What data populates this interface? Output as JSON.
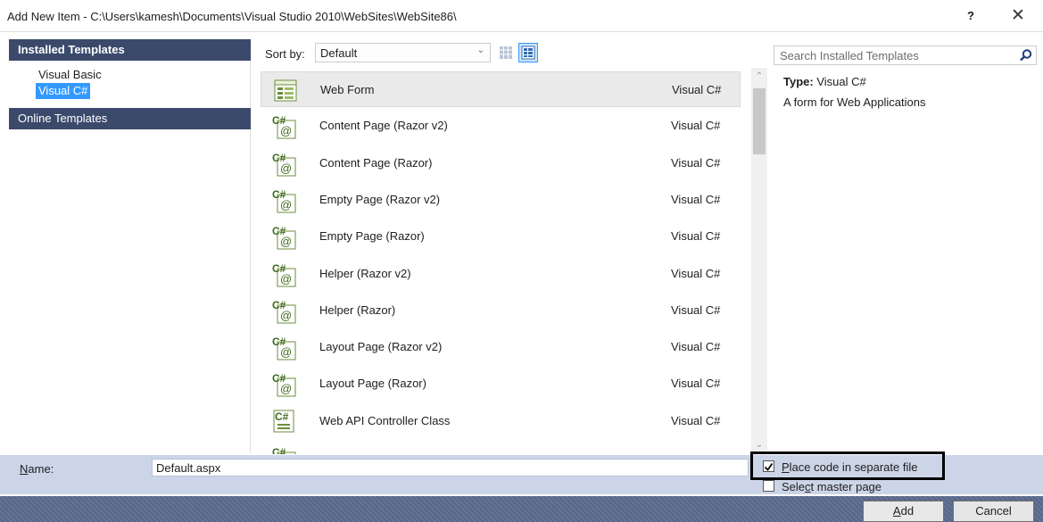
{
  "window": {
    "title": "Add New Item - C:\\Users\\kamesh\\Documents\\Visual Studio 2010\\WebSites\\WebSite86\\",
    "help": "?",
    "close": "✕"
  },
  "left_pane": {
    "installed_header": "Installed Templates",
    "tree": [
      "Visual Basic",
      "Visual C#"
    ],
    "selected_tree_item": "Visual C#",
    "online_header": "Online Templates"
  },
  "toolbar": {
    "sort_label": "Sort by:",
    "sort_value": "Default",
    "view_modes": [
      "small-icons",
      "medium-icons"
    ],
    "active_view": "medium-icons"
  },
  "templates": [
    {
      "name": "Web Form",
      "lang": "Visual C#",
      "icon": "web-form-icon",
      "selected": true
    },
    {
      "name": "Content Page (Razor v2)",
      "lang": "Visual C#",
      "icon": "csharp-razor-icon"
    },
    {
      "name": "Content Page (Razor)",
      "lang": "Visual C#",
      "icon": "csharp-razor-icon"
    },
    {
      "name": "Empty Page (Razor v2)",
      "lang": "Visual C#",
      "icon": "csharp-razor-icon"
    },
    {
      "name": "Empty Page (Razor)",
      "lang": "Visual C#",
      "icon": "csharp-razor-icon"
    },
    {
      "name": "Helper (Razor v2)",
      "lang": "Visual C#",
      "icon": "csharp-razor-icon"
    },
    {
      "name": "Helper (Razor)",
      "lang": "Visual C#",
      "icon": "csharp-razor-icon"
    },
    {
      "name": "Layout Page (Razor v2)",
      "lang": "Visual C#",
      "icon": "csharp-razor-icon"
    },
    {
      "name": "Layout Page (Razor)",
      "lang": "Visual C#",
      "icon": "csharp-razor-icon"
    },
    {
      "name": "Web API Controller Class",
      "lang": "Visual C#",
      "icon": "csharp-class-icon"
    },
    {
      "name": "",
      "lang": "",
      "icon": "csharp-razor-icon"
    }
  ],
  "details": {
    "search_placeholder": "Search Installed Templates",
    "type_label": "Type:",
    "type_value": "Visual C#",
    "description": "A form for Web Applications"
  },
  "name_bar": {
    "label_accel": "N",
    "label_rest": "ame:",
    "value": "Default.aspx",
    "separate_pre": "",
    "separate_accel": "P",
    "separate_rest": "lace code in separate file",
    "separate_checked": true,
    "master_pre": "Sele",
    "master_accel": "c",
    "master_rest": "t master page",
    "master_checked": false
  },
  "buttons": {
    "add_accel": "A",
    "add_rest": "dd",
    "cancel": "Cancel"
  },
  "colors": {
    "header_bg": "#3b4a6b",
    "selection": "#3399ff",
    "name_bar": "#ccd5e7",
    "footer": "#5a6b8d"
  }
}
